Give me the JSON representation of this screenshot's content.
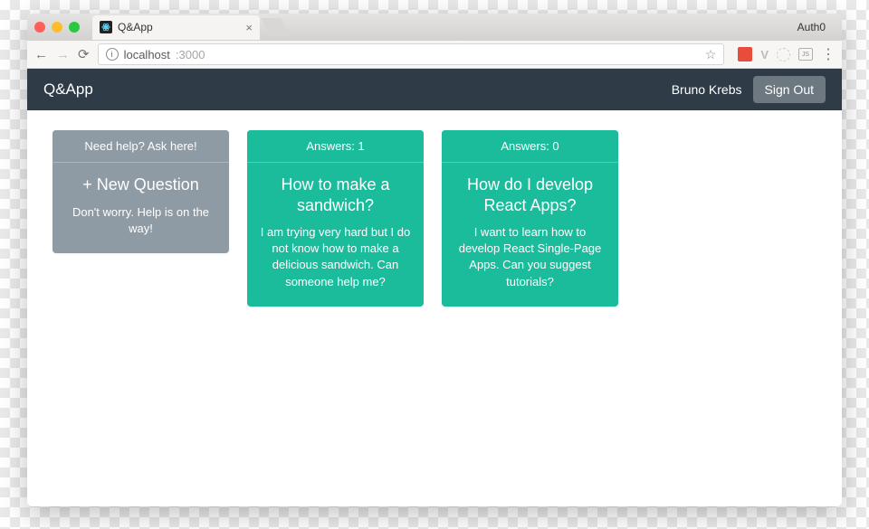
{
  "browser": {
    "profile_label": "Auth0",
    "tab_title": "Q&App",
    "url": {
      "host": "localhost",
      "port": ":3000"
    }
  },
  "app": {
    "brand": "Q&App",
    "user_name": "Bruno Krebs",
    "signout_label": "Sign Out"
  },
  "cards": {
    "new": {
      "header": "Need help? Ask here!",
      "title": "+ New Question",
      "text": "Don't worry. Help is on the way!"
    },
    "questions": [
      {
        "answers_label": "Answers: 1",
        "title": "How to make a sandwich?",
        "text": "I am trying very hard but I do not know how to make a delicious sandwich. Can someone help me?"
      },
      {
        "answers_label": "Answers: 0",
        "title": "How do I develop React Apps?",
        "text": "I want to learn how to develop React Single-Page Apps. Can you suggest tutorials?"
      }
    ]
  }
}
